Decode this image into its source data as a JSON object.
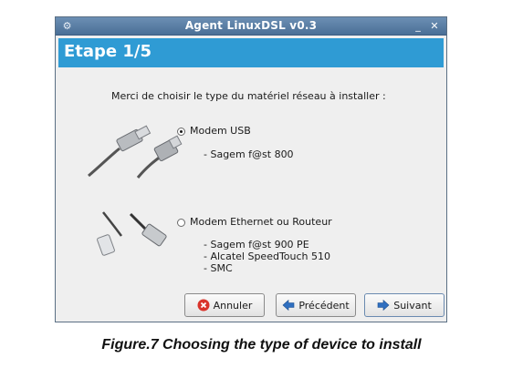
{
  "window": {
    "title": "Agent LinuxDSL v0.3",
    "header": "Etape 1/5"
  },
  "content": {
    "prompt": "Merci de choisir le type du matériel réseau à installer :",
    "options": [
      {
        "label": "Modem USB",
        "selected": true,
        "details": [
          "- Sagem f@st 800"
        ]
      },
      {
        "label": "Modem Ethernet ou Routeur",
        "selected": false,
        "details": [
          "- Sagem f@st 900 PE",
          "- Alcatel SpeedTouch 510",
          "- SMC"
        ]
      }
    ]
  },
  "buttons": {
    "cancel": "Annuler",
    "previous": "Précédent",
    "next": "Suivant"
  },
  "caption": "Figure.7 Choosing the type of device to install",
  "colors": {
    "header": "#2f9bd4",
    "titlebar": "#5a7fa6",
    "cancel_icon": "#d9342b",
    "arrow_icon": "#2f6fc0"
  }
}
